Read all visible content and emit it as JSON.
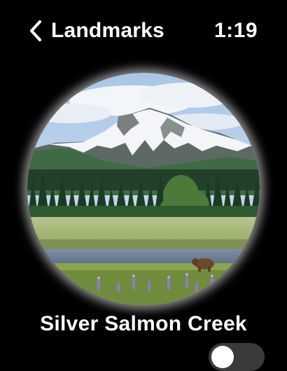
{
  "nav": {
    "back_label": "Landmarks",
    "time": "1:19"
  },
  "landmark": {
    "name": "Silver Salmon Creek",
    "image_icon": "landmark-photo",
    "favorite_on": false
  },
  "colors": {
    "background": "#000000",
    "text": "#ffffff",
    "toggle_off": "#3a3a3c"
  }
}
